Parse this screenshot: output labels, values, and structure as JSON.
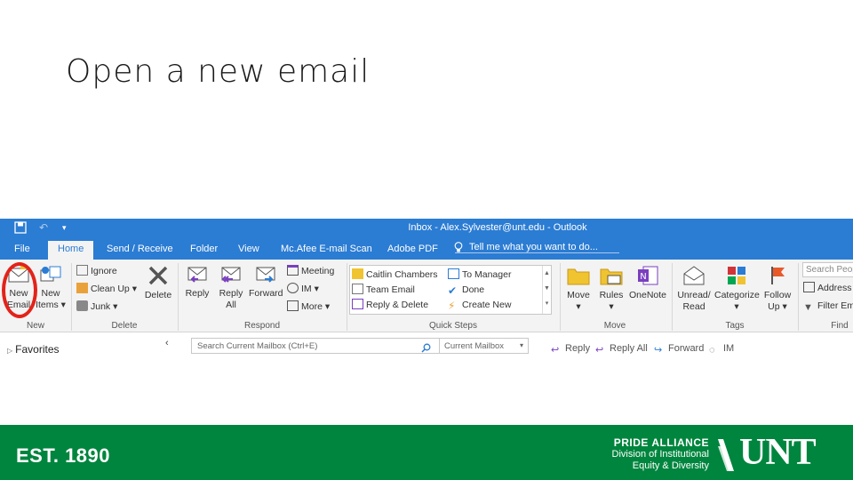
{
  "slide": {
    "title": "Open a new email"
  },
  "window": {
    "title": "Inbox - Alex.Sylvester@unt.edu - Outlook"
  },
  "tabs": [
    "File",
    "Home",
    "Send / Receive",
    "Folder",
    "View",
    "Mc.Afee E-mail Scan",
    "Adobe PDF"
  ],
  "tell_me": "Tell me what you want to do...",
  "ribbon": {
    "new": {
      "new_email_line1": "New",
      "new_email_line2": "Email",
      "new_items_line1": "New",
      "new_items_line2": "Items",
      "label": "New"
    },
    "delete": {
      "ignore": "Ignore",
      "clean_up": "Clean Up",
      "junk": "Junk",
      "delete": "Delete",
      "label": "Delete"
    },
    "respond": {
      "reply": "Reply",
      "reply_all_line1": "Reply",
      "reply_all_line2": "All",
      "forward": "Forward",
      "meeting": "Meeting",
      "im": "IM",
      "more": "More",
      "label": "Respond"
    },
    "quick_steps": {
      "items": [
        "Caitlin Chambers",
        "Team Email",
        "Reply & Delete",
        "To Manager",
        "Done",
        "Create New"
      ],
      "label": "Quick Steps"
    },
    "move": {
      "move": "Move",
      "rules": "Rules",
      "onenote": "OneNote",
      "label": "Move"
    },
    "tags": {
      "unread_line1": "Unread/",
      "unread_line2": "Read",
      "categorize": "Categorize",
      "follow_line1": "Follow",
      "follow_line2": "Up",
      "label": "Tags"
    },
    "find": {
      "search_people": "Search People",
      "address_book": "Address Book",
      "filter_email": "Filter Email",
      "label": "Find"
    }
  },
  "folder_pane": {
    "favorites": "Favorites"
  },
  "mail_search": {
    "placeholder": "Search Current Mailbox (Ctrl+E)",
    "scope": "Current Mailbox"
  },
  "reading_actions": {
    "reply": "Reply",
    "reply_all": "Reply All",
    "forward": "Forward",
    "im": "IM"
  },
  "footer": {
    "est": "EST. 1890",
    "pride_line1": "PRIDE ALLIANCE",
    "pride_line2": "Division of Institutional",
    "pride_line3": "Equity & Diversity",
    "logo_text": "UNT"
  },
  "colors": {
    "outlook_blue": "#2b7cd3",
    "unt_green": "#00853e",
    "highlight_red": "#e2231a"
  }
}
